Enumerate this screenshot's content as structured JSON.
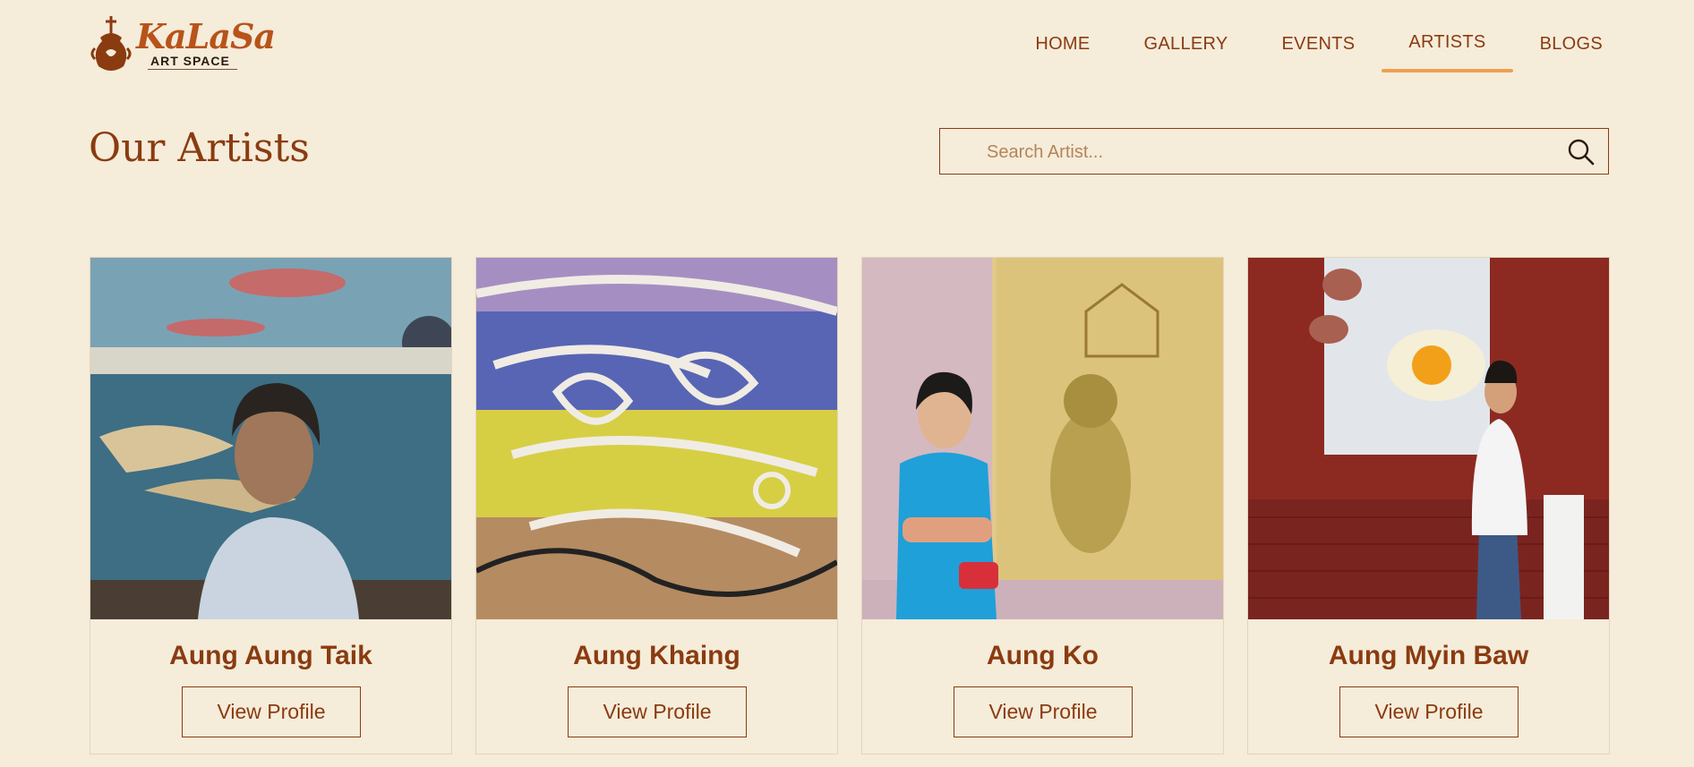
{
  "brand": {
    "name": "KaLaSa",
    "sub": "ART SPACE"
  },
  "nav": [
    {
      "label": "HOME",
      "active": false
    },
    {
      "label": "GALLERY",
      "active": false
    },
    {
      "label": "EVENTS",
      "active": false
    },
    {
      "label": "ARTISTS",
      "active": true
    },
    {
      "label": "BLOGS",
      "active": false
    }
  ],
  "page_title": "Our Artists",
  "search": {
    "placeholder": "Search Artist...",
    "value": ""
  },
  "artists": [
    {
      "name": "Aung Aung Taik",
      "button": "View Profile"
    },
    {
      "name": "Aung Khaing",
      "button": "View Profile"
    },
    {
      "name": "Aung Ko",
      "button": "View Profile"
    },
    {
      "name": "Aung Myin Baw",
      "button": "View Profile"
    }
  ],
  "colors": {
    "background": "#f5ecda",
    "accent": "#8a3b10",
    "active_underline": "#f0a050"
  }
}
